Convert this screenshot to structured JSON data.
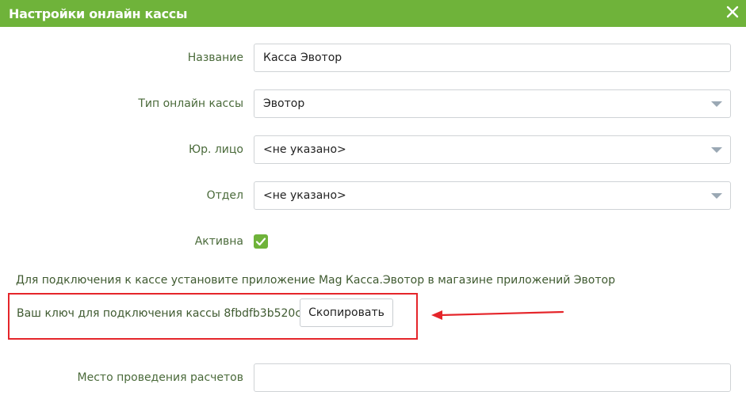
{
  "dialog": {
    "title": "Настройки онлайн кассы",
    "close_icon": "close-icon"
  },
  "form": {
    "name": {
      "label": "Название",
      "value": "Касса Эвотор"
    },
    "type": {
      "label": "Тип онлайн кассы",
      "value": "Эвотор"
    },
    "legal": {
      "label": "Юр. лицо",
      "value": "<не указано>"
    },
    "department": {
      "label": "Отдел",
      "value": "<не указано>"
    },
    "active": {
      "label": "Активна",
      "checked": true
    },
    "info": "Для подключения к кассе установите приложение Mag Касса.Эвотор в магазине приложений Эвотор",
    "key_text": "Ваш ключ для подключения кассы 8fbdfb3b520ca9e7",
    "copy_label": "Скопировать",
    "place": {
      "label": "Место проведения расчетов",
      "value": ""
    }
  },
  "colors": {
    "header": "#6fb33a",
    "highlight": "#e5252a"
  }
}
